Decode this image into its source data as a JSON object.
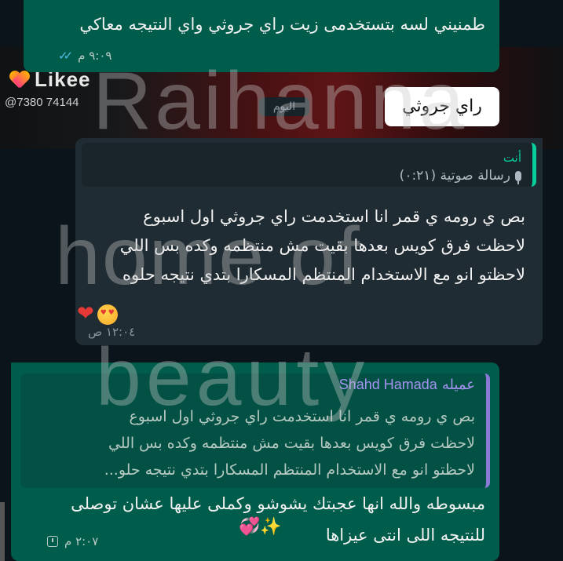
{
  "background": {
    "brand_word": "Likee",
    "user_id": "@7380 74144"
  },
  "messages": [
    {
      "id": "msg1",
      "direction": "outgoing",
      "text": "طمنيني لسه بتستخدمى زيت راي جروثي واي النتيجه معاكي",
      "time": "٩:٠٩ م",
      "status": "read"
    },
    {
      "id": "msg2",
      "direction": "incoming",
      "quoted": {
        "author": "أنت",
        "text": "رسالة صوتية (٠:٢١)",
        "icon": "mic-icon"
      },
      "lines": [
        "بص ي رومه ي قمر انا استخدمت راي جروثي اول اسبوع",
        "لاحظت فرق كويس بعدها بقيت مش منتظمه وكده بس اللي",
        "لاحظتو انو مع الاستخدام المنتظم المسكارا بتدي نتيجه حلوه"
      ],
      "emojis": "❤️🥰",
      "time": "١٢:٠٤ ص"
    },
    {
      "id": "msg3",
      "direction": "outgoing",
      "quoted": {
        "label": "عميله",
        "author": "Shahd Hamada",
        "lines": [
          "بص ي رومه ي قمر انا استخدمت راي جروثي اول اسبوع",
          "لاحظت فرق كويس بعدها بقيت مش منتظمه وكده بس اللي",
          "لاحظتو انو مع الاستخدام المنتظم المسكارا بتدي نتيجه حلو..."
        ]
      },
      "lines": [
        "مبسوطه والله انها عجبتك يشوشو وكملى عليها عشان توصلى",
        "للنتيجه اللى انتى عيزاها"
      ],
      "emojis": "💞✨",
      "time": "٢:٠٧ م",
      "status": "pending"
    }
  ],
  "day_chip": "اليوم",
  "label_chip": "راي جروثي",
  "watermark": [
    "Raihanna",
    "home of",
    "beauty"
  ]
}
